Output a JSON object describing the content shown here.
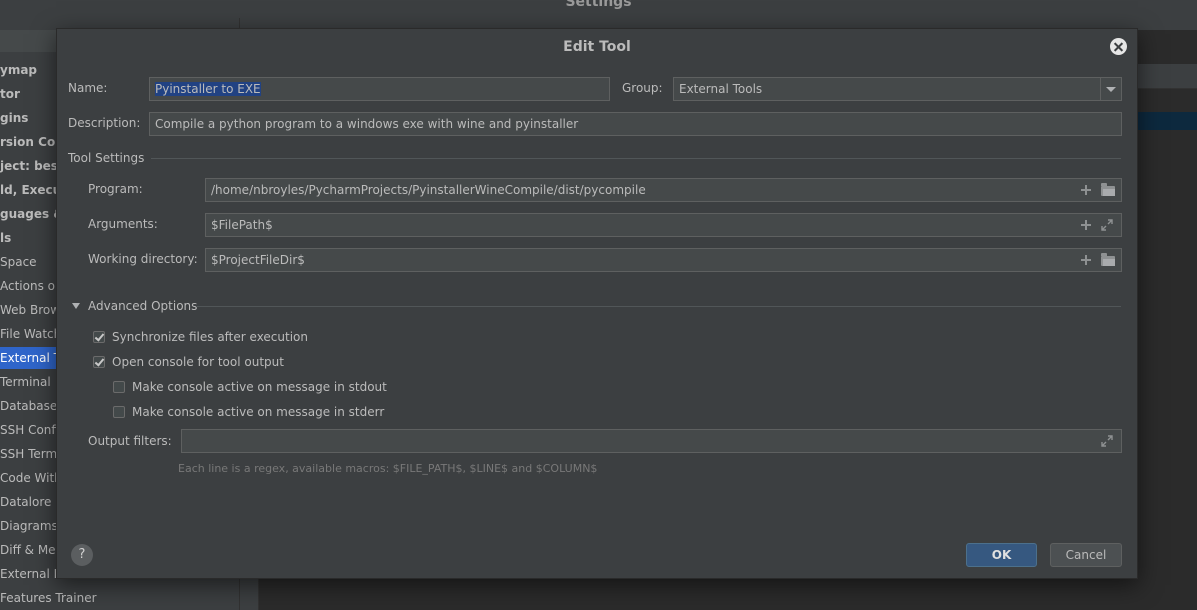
{
  "background": {
    "window_title": "Settings",
    "sidebar_items": [
      {
        "label": "ymap",
        "bold": true
      },
      {
        "label": "tor",
        "bold": true
      },
      {
        "label": "gins",
        "bold": true
      },
      {
        "label": "rsion Cont",
        "bold": true
      },
      {
        "label": "ject: bestr",
        "bold": true
      },
      {
        "label": "ld, Execut",
        "bold": true
      },
      {
        "label": "guages &",
        "bold": true
      },
      {
        "label": "ls",
        "bold": true
      },
      {
        "label": "Space",
        "bold": false
      },
      {
        "label": "Actions on",
        "bold": false
      },
      {
        "label": "Web Brows",
        "bold": false
      },
      {
        "label": "File Watche",
        "bold": false
      },
      {
        "label": "External To",
        "bold": false,
        "selected": true
      },
      {
        "label": "Terminal",
        "bold": false
      },
      {
        "label": "Database",
        "bold": false
      },
      {
        "label": "SSH Config",
        "bold": false
      },
      {
        "label": "SSH Termi",
        "bold": false
      },
      {
        "label": "Code With",
        "bold": false
      },
      {
        "label": "Datalore",
        "bold": false
      },
      {
        "label": "Diagrams",
        "bold": false
      },
      {
        "label": "Diff & Mer",
        "bold": false
      },
      {
        "label": "External Documentation",
        "bold": false
      },
      {
        "label": "Features Trainer",
        "bold": false
      }
    ]
  },
  "dialog": {
    "title": "Edit Tool",
    "name_label": "Name:",
    "name_value": "Pyinstaller to EXE",
    "group_label": "Group:",
    "group_value": "External Tools",
    "description_label": "Description:",
    "description_value": "Compile a python program to a windows exe with wine and pyinstaller",
    "tool_settings_title": "Tool Settings",
    "program_label": "Program:",
    "program_value": "/home/nbroyles/PycharmProjects/PyinstallerWineCompile/dist/pycompile",
    "arguments_label": "Arguments:",
    "arguments_value": "$FilePath$",
    "workdir_label": "Working directory:",
    "workdir_value": "$ProjectFileDir$",
    "advanced_title": "Advanced Options",
    "options": [
      {
        "label": "Synchronize files after execution",
        "checked": true
      },
      {
        "label": "Open console for tool output",
        "checked": true
      },
      {
        "label": "Make console active on message in stdout",
        "checked": false
      },
      {
        "label": "Make console active on message in stderr",
        "checked": false
      }
    ],
    "output_filters_label": "Output filters:",
    "output_filters_value": "",
    "hint": "Each line is a regex, available macros: $FILE_PATH$, $LINE$ and $COLUMN$",
    "help_label": "?",
    "ok_label": "OK",
    "cancel_label": "Cancel"
  }
}
